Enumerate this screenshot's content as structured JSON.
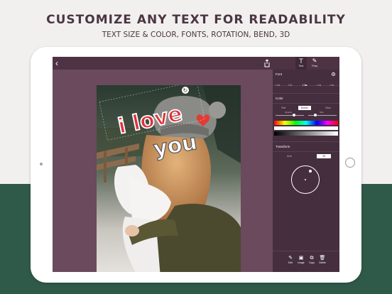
{
  "headline": "CUSTOMIZE ANY TEXT FOR READABILITY",
  "subhead": "TEXT SIZE & COLOR, FONTS, ROTATION, BEND, 3D",
  "toolbar": {
    "back_icon": "chevron-left-icon",
    "share_icon": "share-icon",
    "text_tool_glyph": "T",
    "text_tool_label": "Text",
    "freq_tool_glyph": "✎",
    "freq_tool_label": "Freq"
  },
  "canvas": {
    "overlay_text_1": "i love",
    "overlay_text_2": "you",
    "rotate_handle_glyph": "↻",
    "heart_glyph": "♥"
  },
  "panel": {
    "font_label": "Font",
    "font_options": [
      "i 1a",
      "Cd",
      "i 1a",
      "i 1a",
      "i 1a"
    ],
    "font_selected_index": 2,
    "color_label": "Color",
    "color_tabs": [
      "Text",
      "Border",
      "Glow"
    ],
    "color_tab_selected": 1,
    "opacity_label": "Opacity",
    "size_label": "Size",
    "transform_label": "Transform",
    "transform_tabs": [
      "Arch",
      "3D"
    ],
    "transform_tab_selected": 1,
    "actions": [
      {
        "icon": "edit-icon",
        "glyph": "✎",
        "label": "Edit"
      },
      {
        "icon": "image-icon",
        "glyph": "▣",
        "label": "Image"
      },
      {
        "icon": "copy-icon",
        "glyph": "⧉",
        "label": "Copy"
      },
      {
        "icon": "delete-icon",
        "glyph": "🗑",
        "label": "Delete"
      }
    ]
  },
  "colors": {
    "brand_dark": "#4a3642",
    "app_bg": "#5a3c4e",
    "panel_bg": "#452e3e",
    "heart": "#e33b33",
    "text_red": "#e0303a",
    "band_green": "#2f5a4a"
  }
}
